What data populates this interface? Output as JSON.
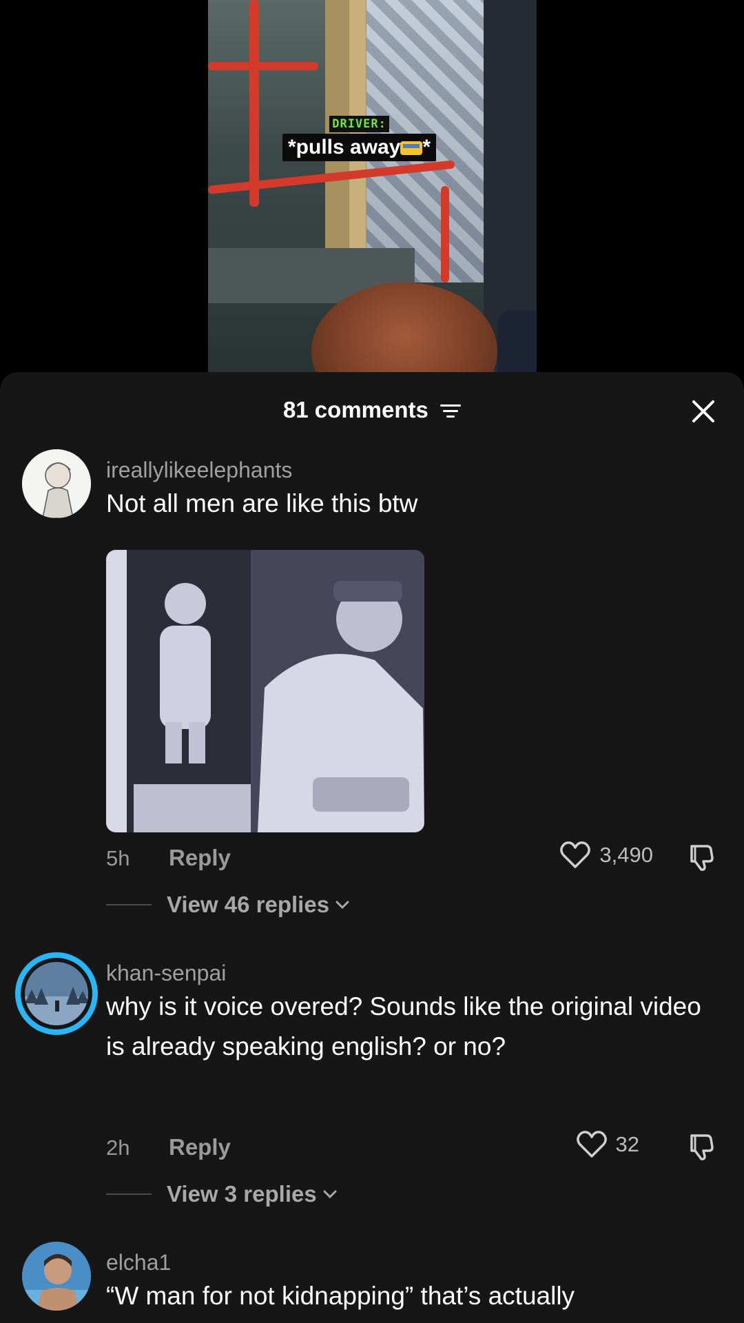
{
  "video": {
    "caption_speaker": "DRIVER:",
    "caption_text": "*pulls away",
    "caption_end": "*"
  },
  "sheet": {
    "count": "81 comments",
    "colors": {
      "sheet_bg": "#161616",
      "text_secondary": "#9a9a9a",
      "avatar_ring": "#29b6f6"
    }
  },
  "comments": [
    {
      "username": "ireallylikeelephants",
      "text": "Not all men are like this btw",
      "time": "5h",
      "reply_label": "Reply",
      "likes": "3,490",
      "view_replies": "View 46 replies",
      "has_image": true
    },
    {
      "username": "khan-senpai",
      "text": "why is it voice overed? Sounds like the original video is already speaking english? or no?",
      "time": "2h",
      "reply_label": "Reply",
      "likes": "32",
      "view_replies": "View 3 replies"
    },
    {
      "username": "elcha1",
      "text": "“W man for not kidnapping” that’s actually"
    }
  ]
}
